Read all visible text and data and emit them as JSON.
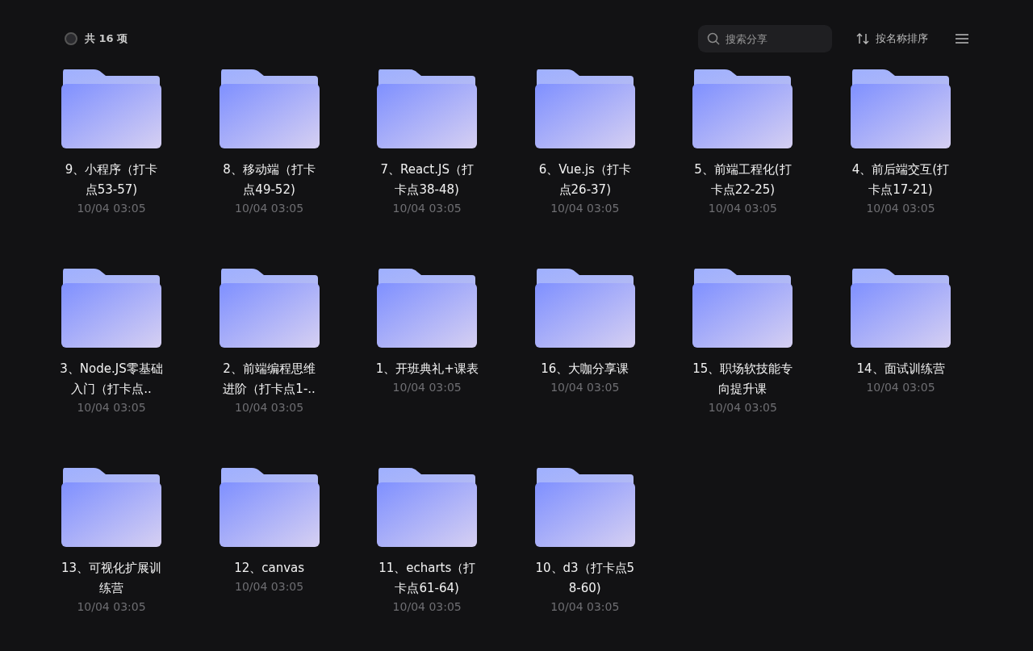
{
  "toolbar": {
    "select_all": {
      "checked": false
    },
    "count": "共 16 项",
    "search": {
      "placeholder": "搜索分享"
    },
    "sort": "按名称排序"
  },
  "folders": [
    {
      "name": "9、小程序（打卡点53-57)",
      "time": "10/04 03:05"
    },
    {
      "name": "8、移动端（打卡点49-52)",
      "time": "10/04 03:05"
    },
    {
      "name": "7、React.JS（打卡点38-48)",
      "time": "10/04 03:05"
    },
    {
      "name": "6、Vue.js（打卡点26-37)",
      "time": "10/04 03:05"
    },
    {
      "name": "5、前端工程化(打卡点22-25)",
      "time": "10/04 03:05"
    },
    {
      "name": "4、前后端交互(打卡点17-21)",
      "time": "10/04 03:05"
    },
    {
      "name": "3、Node.JS零基础入门（打卡点..",
      "time": "10/04 03:05"
    },
    {
      "name": "2、前端编程思维进阶（打卡点1-..",
      "time": "10/04 03:05"
    },
    {
      "name": "1、开班典礼+课表",
      "time": "10/04 03:05"
    },
    {
      "name": "16、大咖分享课",
      "time": "10/04 03:05"
    },
    {
      "name": "15、职场软技能专向提升课",
      "time": "10/04 03:05"
    },
    {
      "name": "14、面试训练营",
      "time": "10/04 03:05"
    },
    {
      "name": "13、可视化扩展训练营",
      "time": "10/04 03:05"
    },
    {
      "name": "12、canvas",
      "time": "10/04 03:05"
    },
    {
      "name": "11、echarts（打卡点61-64)",
      "time": "10/04 03:05"
    },
    {
      "name": "10、d3（打卡点58-60)",
      "time": "10/04 03:05"
    }
  ]
}
